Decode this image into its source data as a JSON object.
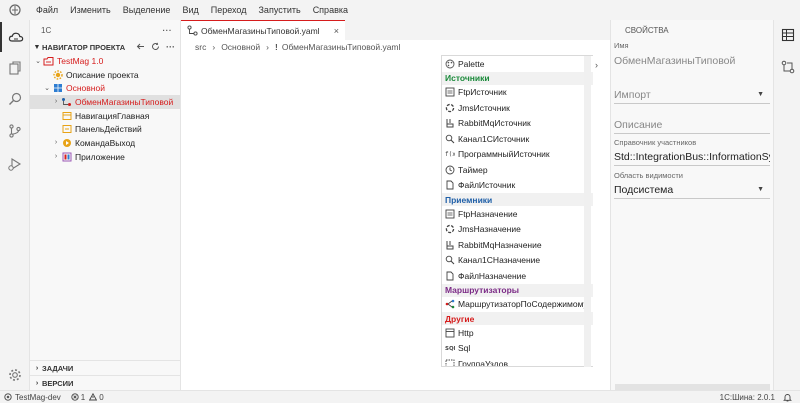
{
  "menu": [
    "Файл",
    "Изменить",
    "Выделение",
    "Вид",
    "Переход",
    "Запустить",
    "Справка"
  ],
  "sidebar": {
    "title": "1С",
    "more": "···",
    "navigator_title": "НАВИГАТОР ПРОЕКТА",
    "tree": [
      {
        "label": "TestMag 1.0",
        "level": 0,
        "twisty": "⌄",
        "color": "#d61c1c"
      },
      {
        "label": "Описание проекта",
        "level": 1,
        "twisty": "",
        "color": "#222222"
      },
      {
        "label": "Основной",
        "level": 1,
        "twisty": "⌄",
        "color": "#d61c1c"
      },
      {
        "label": "ОбменМагазиныТиповой",
        "level": 2,
        "twisty": "›",
        "color": "#d61c1c",
        "selected": true
      },
      {
        "label": "НавигацияГлавная",
        "level": 2,
        "twisty": "",
        "color": "#222222"
      },
      {
        "label": "ПанельДействий",
        "level": 2,
        "twisty": "",
        "color": "#222222"
      },
      {
        "label": "КомандаВыход",
        "level": 2,
        "twisty": "›",
        "color": "#222222"
      },
      {
        "label": "Приложение",
        "level": 2,
        "twisty": "›",
        "color": "#222222"
      }
    ],
    "bottom_sections": [
      "ЗАДАЧИ",
      "ВЕРСИИ"
    ]
  },
  "editor": {
    "tab_label": "ОбменМагазиныТиповой.yaml",
    "tab_close": "×",
    "breadcrumb": [
      "src",
      "Основной",
      "ОбменМагазиныТиповой.yaml"
    ],
    "breadcrumb_mark": "!",
    "palette_toggle": "›"
  },
  "palette": {
    "top": "Palette",
    "groups": [
      {
        "title": "Источники",
        "color": "#1a8a3a",
        "items": [
          "FtpИсточник",
          "JmsИсточник",
          "RabbitMqИсточник",
          "Канал1СИсточник",
          "ПрограммныйИсточник",
          "Таймер",
          "ФайлИсточник"
        ]
      },
      {
        "title": "Приемники",
        "color": "#1f5fa8",
        "items": [
          "FtpНазначение",
          "JmsНазначение",
          "RabbitMqНазначение",
          "Канал1СНазначение",
          "ФайлНазначение"
        ]
      },
      {
        "title": "Маршрутизаторы",
        "color": "#7b2a86",
        "items": [
          "МаршрутизаторПоСодержимому"
        ]
      },
      {
        "title": "Другие",
        "color": "#d61c1c",
        "items": [
          "Http",
          "Sql",
          "ГруппаУзлов"
        ]
      }
    ]
  },
  "properties": {
    "title": "СВОЙСТВА",
    "name_label": "Имя",
    "name_value": "ОбменМагазиныТиповой",
    "import_value": "Импорт",
    "description_placeholder": "Описание",
    "participants_label": "Справочник участников",
    "participants_value": "Std::IntegrationBus::InformationSys",
    "scope_label": "Область видимости",
    "scope_value": "Подсистема"
  },
  "statusbar": {
    "branch": "TestMag-dev",
    "errors": "1",
    "warnings": "0",
    "version": "1С:Шина: 2.0.1"
  }
}
